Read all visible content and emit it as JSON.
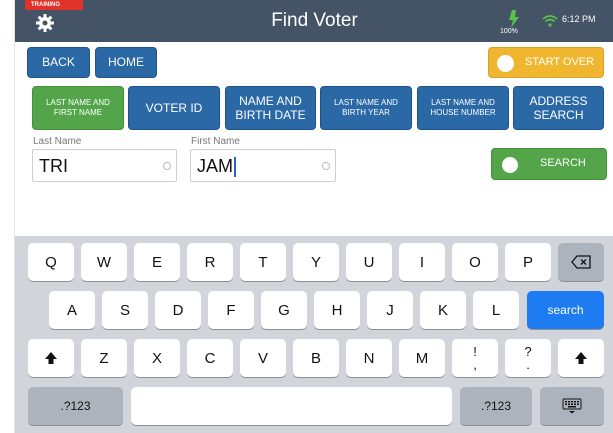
{
  "header": {
    "training_badge": "TRAINING",
    "title": "Find Voter",
    "battery": "100%",
    "time": "6:12 PM"
  },
  "nav": {
    "back": "BACK",
    "home": "HOME",
    "start_over": "START OVER"
  },
  "search_tabs": [
    {
      "line1": "LAST NAME AND",
      "line2": "FIRST NAME"
    },
    {
      "line1": "VOTER ID",
      "line2": ""
    },
    {
      "line1": "NAME AND",
      "line2": "BIRTH DATE"
    },
    {
      "line1": "LAST NAME AND",
      "line2": "BIRTH YEAR"
    },
    {
      "line1": "LAST NAME AND",
      "line2": "HOUSE NUMBER"
    },
    {
      "line1": "ADDRESS",
      "line2": "SEARCH"
    }
  ],
  "form": {
    "last_name_label": "Last Name",
    "last_name_value": "TRI",
    "first_name_label": "First Name",
    "first_name_value": "JAM",
    "search_button": "SEARCH"
  },
  "keyboard": {
    "row1": [
      "Q",
      "W",
      "E",
      "R",
      "T",
      "Y",
      "U",
      "I",
      "O",
      "P"
    ],
    "row2": [
      "A",
      "S",
      "D",
      "F",
      "G",
      "H",
      "J",
      "K",
      "L"
    ],
    "row3": [
      "Z",
      "X",
      "C",
      "V",
      "B",
      "N",
      "M",
      "!",
      "?"
    ],
    "row3_sub": [
      ",",
      "."
    ],
    "search_key": "search",
    "numbers_key": ".?123"
  },
  "colors": {
    "topbar": "#445366",
    "blue_button": "#2b68a6",
    "green_button": "#54a54a",
    "yellow_button": "#f0b62f",
    "training": "#e0312a",
    "keyboard_bg": "#d1d5db",
    "search_key": "#1d7cf2"
  }
}
